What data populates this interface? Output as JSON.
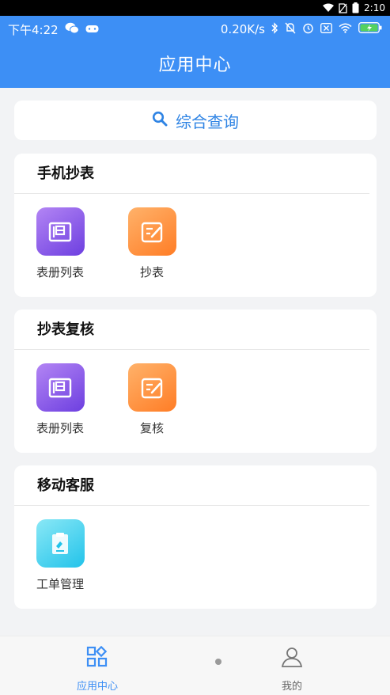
{
  "system_bar": {
    "time": "2:10"
  },
  "status": {
    "time": "下午4:22",
    "speed": "0.20K/s"
  },
  "header": {
    "title": "应用中心"
  },
  "search": {
    "label": "综合查询"
  },
  "sections": [
    {
      "title": "手机抄表",
      "apps": [
        {
          "label": "表册列表",
          "icon": "book-list-icon",
          "color": "purple"
        },
        {
          "label": "抄表",
          "icon": "edit-note-icon",
          "color": "orange"
        }
      ]
    },
    {
      "title": "抄表复核",
      "apps": [
        {
          "label": "表册列表",
          "icon": "book-list-icon",
          "color": "purple"
        },
        {
          "label": "复核",
          "icon": "edit-note-icon",
          "color": "orange"
        }
      ]
    },
    {
      "title": "移动客服",
      "apps": [
        {
          "label": "工单管理",
          "icon": "work-order-icon",
          "color": "cyan"
        }
      ]
    }
  ],
  "bottom_nav": {
    "items": [
      {
        "label": "应用中心",
        "icon": "app-grid-icon"
      },
      {
        "label": "我的",
        "icon": "user-icon"
      }
    ],
    "active_color": "#3d8ff5",
    "inactive_color": "#666666"
  }
}
